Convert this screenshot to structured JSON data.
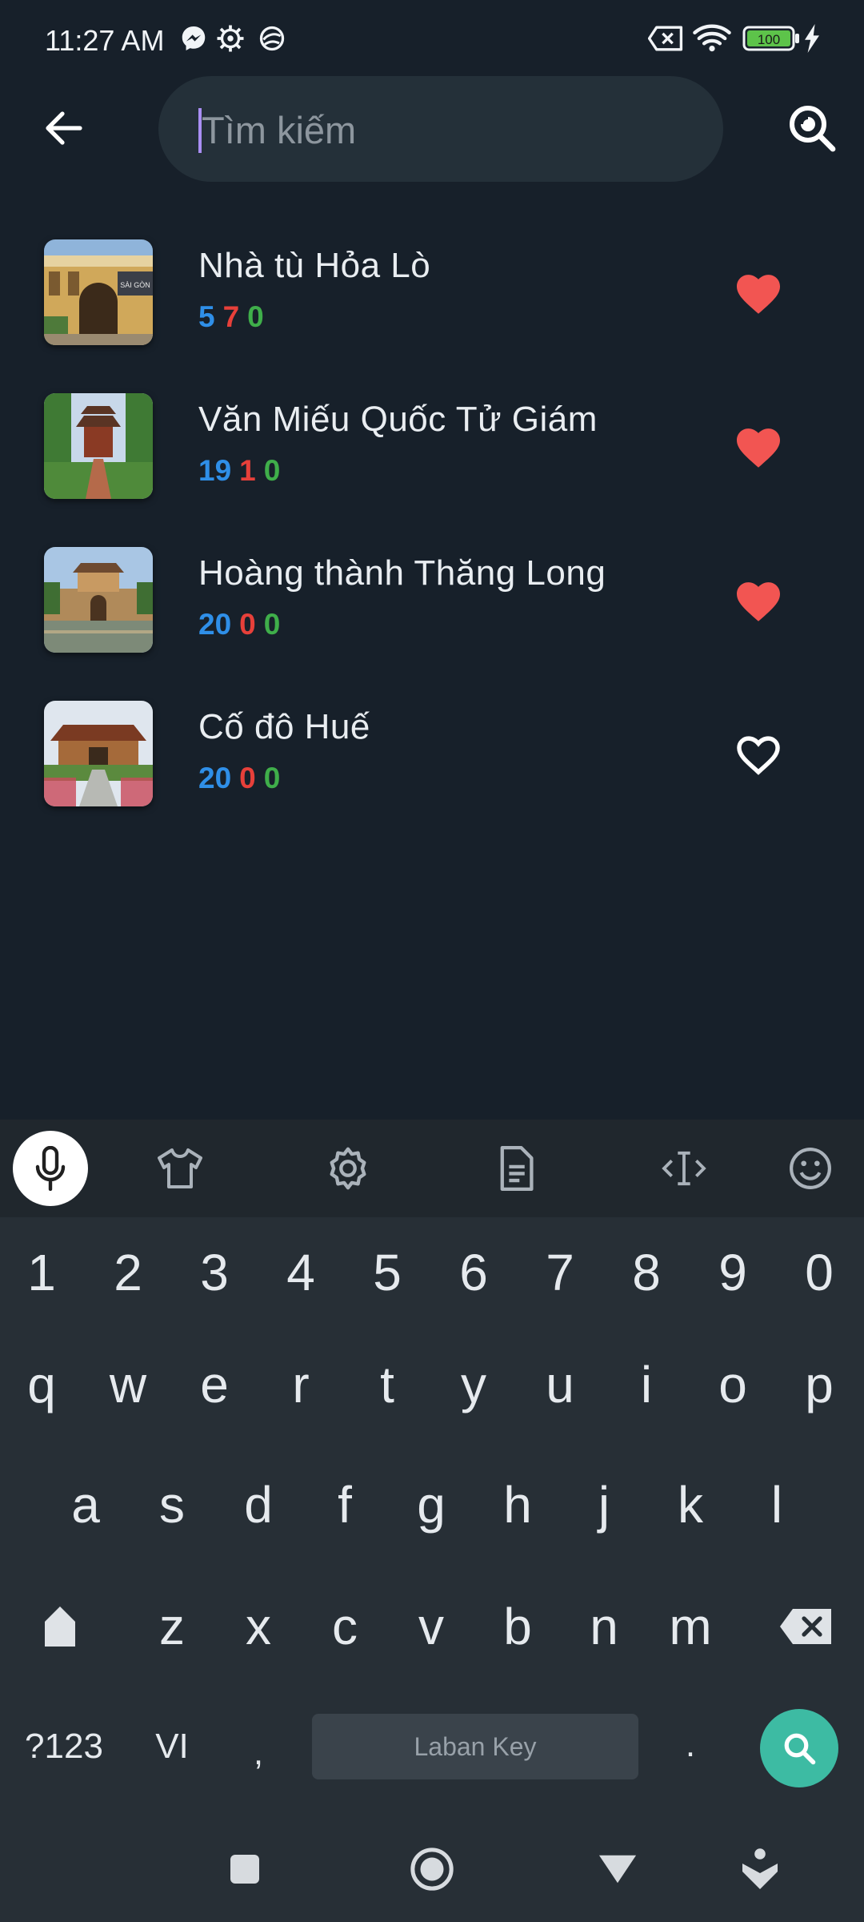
{
  "status_bar": {
    "time": "11:27 AM",
    "battery": "100",
    "icons": [
      "messenger-icon",
      "settings-icon",
      "sync-icon",
      "sim-off-icon",
      "wifi-icon",
      "battery-icon",
      "charging-icon"
    ]
  },
  "search": {
    "placeholder": "Tìm kiếm",
    "value": ""
  },
  "places": [
    {
      "name": "Nhà tù Hỏa Lò",
      "count_blue": "5",
      "count_red": "7",
      "count_green": "0",
      "favorite": true
    },
    {
      "name": "Văn Miếu Quốc Tử Giám",
      "count_blue": "19",
      "count_red": "1",
      "count_green": "0",
      "favorite": true
    },
    {
      "name": "Hoàng thành Thăng Long",
      "count_blue": "20",
      "count_red": "0",
      "count_green": "0",
      "favorite": true
    },
    {
      "name": "Cố đô Huế",
      "count_blue": "20",
      "count_red": "0",
      "count_green": "0",
      "favorite": false
    }
  ],
  "keyboard": {
    "numbers": [
      "1",
      "2",
      "3",
      "4",
      "5",
      "6",
      "7",
      "8",
      "9",
      "0"
    ],
    "row1": [
      "q",
      "w",
      "e",
      "r",
      "t",
      "y",
      "u",
      "i",
      "o",
      "p"
    ],
    "row2": [
      "a",
      "s",
      "d",
      "f",
      "g",
      "h",
      "j",
      "k",
      "l"
    ],
    "row3": [
      "z",
      "x",
      "c",
      "v",
      "b",
      "n",
      "m"
    ],
    "symbols_label": "?123",
    "lang_label": "VI",
    "comma": ",",
    "period": ".",
    "space_label": "Laban Key"
  },
  "colors": {
    "background": "#17202a",
    "heart": "#f25552",
    "accent_go": "#3dbba3",
    "count_blue": "#2f8fe8",
    "count_red": "#e7403a",
    "count_green": "#3fae4a"
  }
}
